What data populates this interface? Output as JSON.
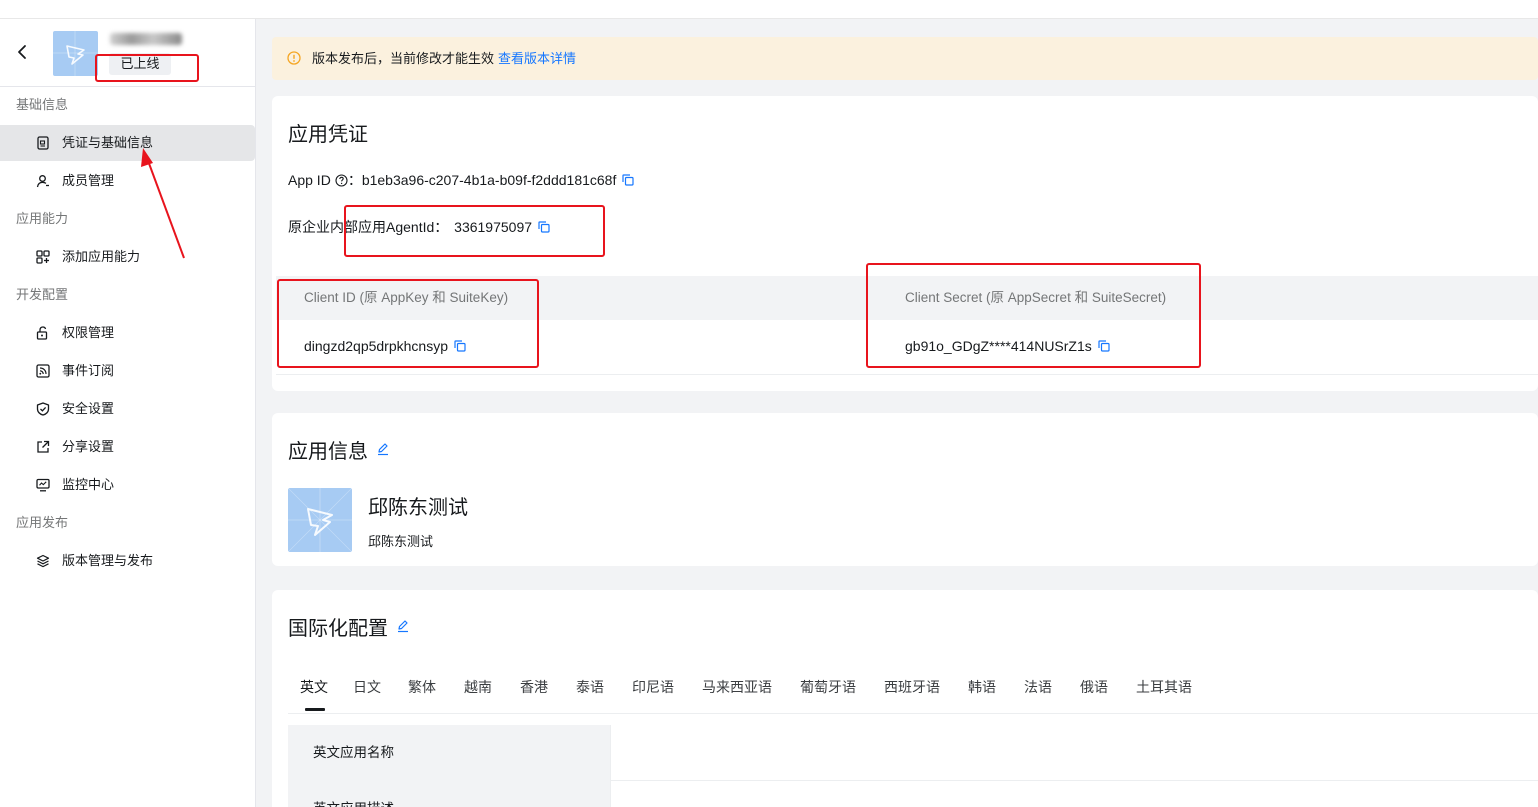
{
  "sidebar": {
    "status_badge": "已上线",
    "groups": [
      {
        "label": "基础信息"
      },
      {
        "label": "应用能力"
      },
      {
        "label": "开发配置"
      },
      {
        "label": "应用发布"
      }
    ],
    "items": [
      {
        "label": "凭证与基础信息",
        "icon": "doc-icon",
        "active": true
      },
      {
        "label": "成员管理",
        "icon": "user-icon"
      },
      {
        "label": "添加应用能力",
        "icon": "grid-plus-icon"
      },
      {
        "label": "权限管理",
        "icon": "lock-icon"
      },
      {
        "label": "事件订阅",
        "icon": "rss-icon"
      },
      {
        "label": "安全设置",
        "icon": "shield-icon"
      },
      {
        "label": "分享设置",
        "icon": "share-icon"
      },
      {
        "label": "监控中心",
        "icon": "monitor-icon"
      },
      {
        "label": "版本管理与发布",
        "icon": "layers-icon"
      }
    ]
  },
  "notice": {
    "text": "版本发布后，当前修改才能生效",
    "link": "查看版本详情"
  },
  "credentials": {
    "title": "应用凭证",
    "app_id_label": "App ID",
    "app_id_sep": "：",
    "app_id_value": "b1eb3a96-c207-4b1a-b09f-f2ddd181c68f",
    "agent_id_label": "原企业内部应用AgentId：",
    "agent_id_value": "3361975097",
    "client_id_header": "Client ID (原 AppKey 和 SuiteKey)",
    "client_id_value": "dingzd2qp5drpkhcnsyp",
    "client_secret_header": "Client Secret (原 AppSecret 和 SuiteSecret)",
    "client_secret_value": "gb91o_GDgZ****414NUSrZ1s"
  },
  "app_info": {
    "title": "应用信息",
    "name": "邱陈东测试",
    "description": "邱陈东测试"
  },
  "i18n": {
    "title": "国际化配置",
    "tabs": [
      "英文",
      "日文",
      "繁体",
      "越南",
      "香港",
      "泰语",
      "印尼语",
      "马来西亚语",
      "葡萄牙语",
      "西班牙语",
      "韩语",
      "法语",
      "俄语",
      "土耳其语"
    ],
    "active_tab": "英文",
    "rows": [
      {
        "key": "英文应用名称",
        "value": ""
      },
      {
        "key": "英文应用描述",
        "value": ""
      }
    ]
  },
  "colors": {
    "accent": "#1677ff",
    "annotation": "#e8141d",
    "notice_bg": "#fbf1de"
  }
}
